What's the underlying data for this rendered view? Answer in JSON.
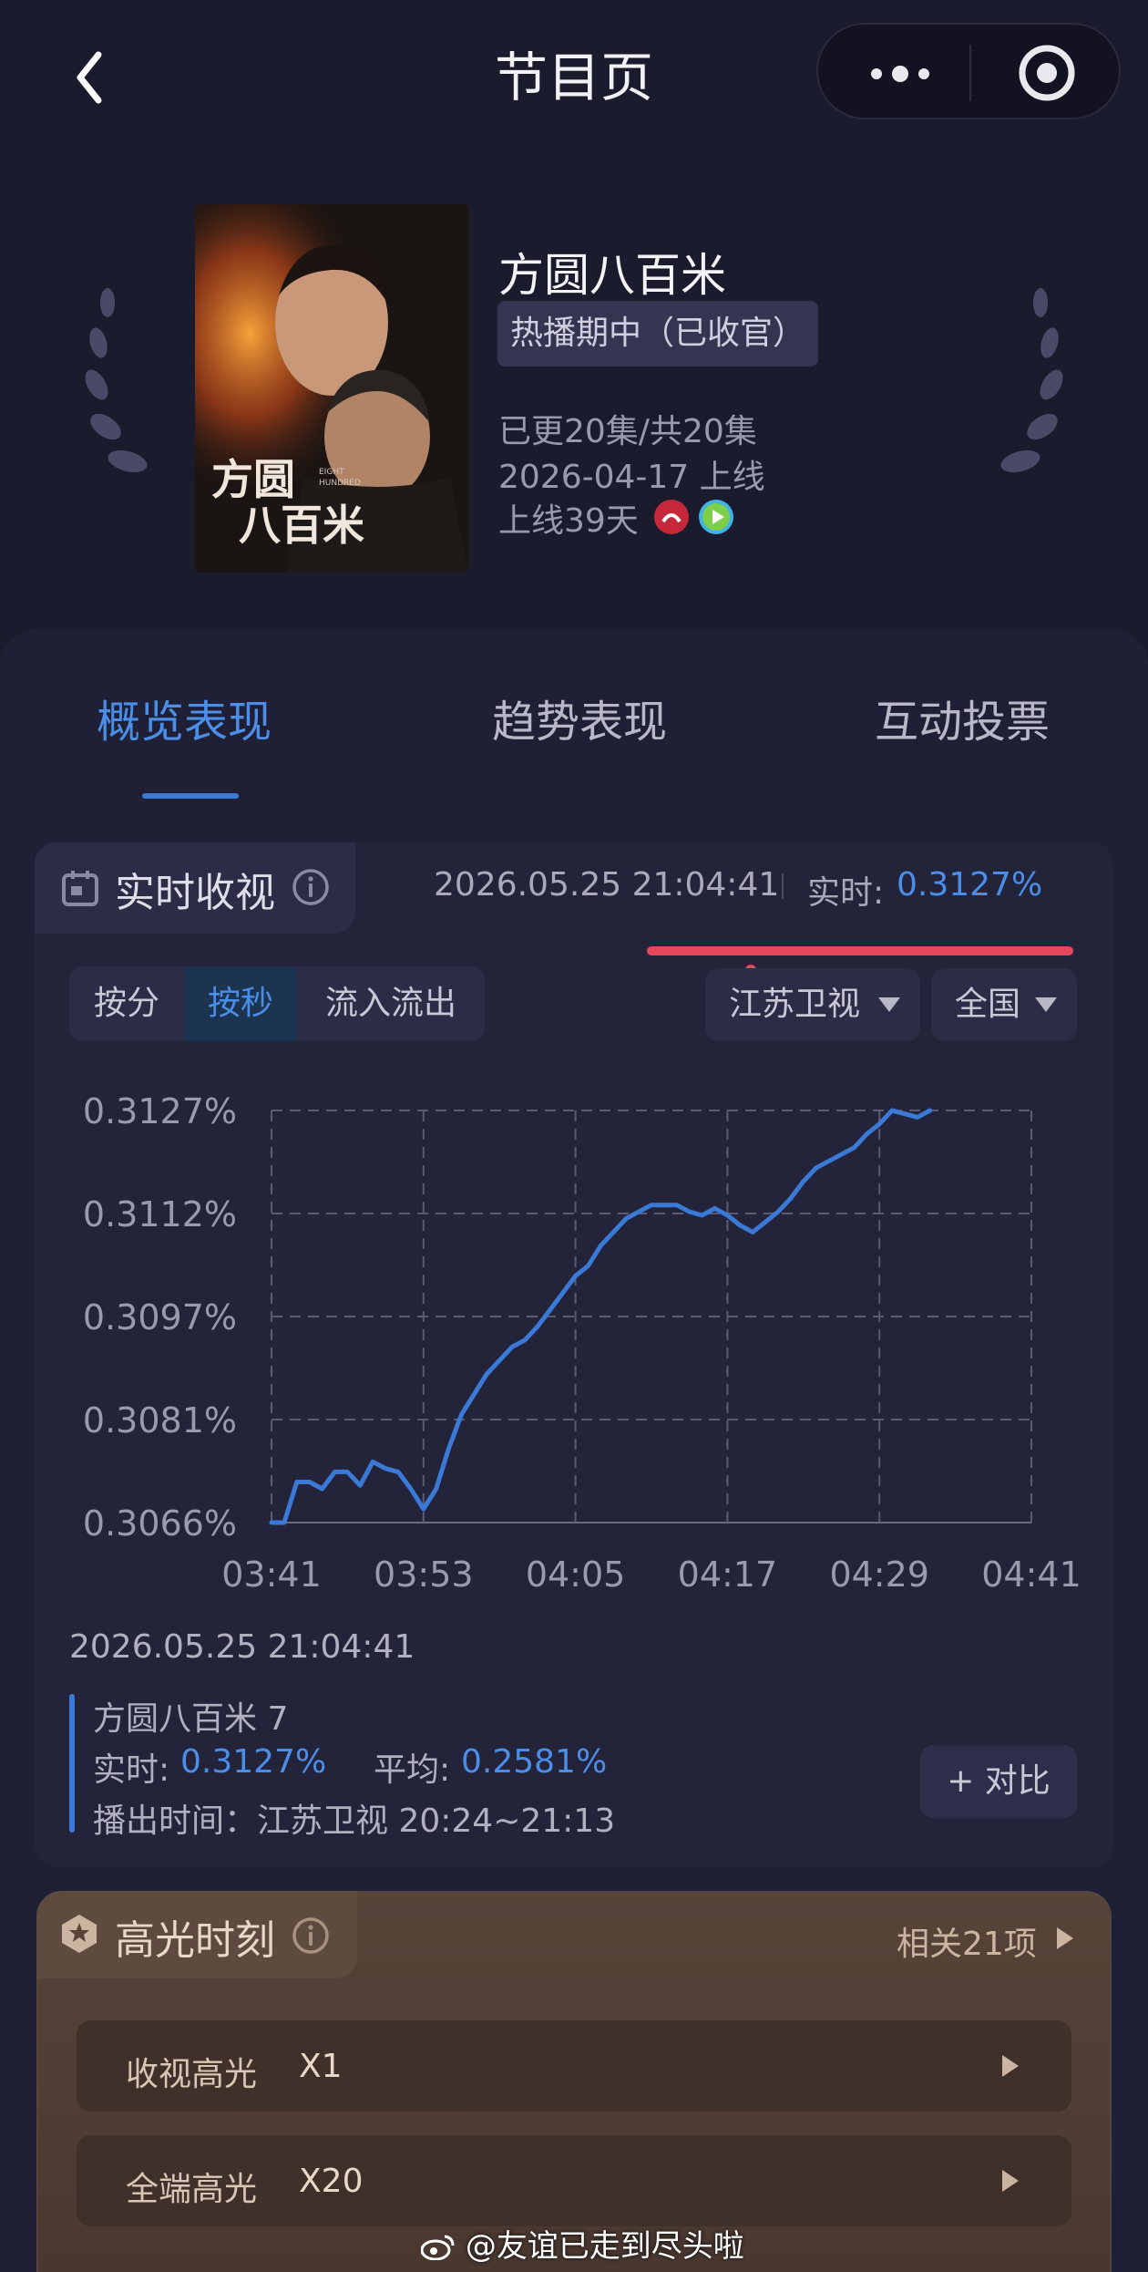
{
  "header": {
    "title": "节目页",
    "back_icon": "chevron-left-icon",
    "more_icon": "more-dots-icon",
    "capsule_close_icon": "target-circle-icon"
  },
  "show": {
    "name": "方圆八百米",
    "status": "热播期中（已收官）",
    "episodes": "已更20集/共20集",
    "release_date": "2026-04-17 上线",
    "days_online": "上线39天",
    "poster_title": "方圆八百米",
    "poster_subtitle": "EIGHT HUNDRED"
  },
  "tabs": [
    {
      "label": "概览表现",
      "active": true
    },
    {
      "label": "趋势表现"
    },
    {
      "label": "互动投票"
    }
  ],
  "realtime": {
    "title": "实时收视",
    "timestamp": "2026.05.25 21:04:41",
    "realtime_label": "实时:",
    "realtime_value": "0.3127%",
    "segments": [
      "按分",
      "按秒",
      "流入流出"
    ],
    "active_segment": "按秒",
    "channel": "江苏卫视",
    "region": "全国"
  },
  "chart_data": {
    "type": "line",
    "y_ticks": [
      "0.3127%",
      "0.3112%",
      "0.3097%",
      "0.3081%",
      "0.3066%"
    ],
    "x_ticks": [
      "03:41",
      "03:53",
      "04:05",
      "04:17",
      "04:29",
      "04:41"
    ],
    "ylim": [
      0.3066,
      0.3127
    ],
    "grid": true,
    "series": [
      {
        "color": "#3a7ad6",
        "x_minutes": [
          0,
          1,
          2,
          3,
          4,
          5,
          6,
          7,
          8,
          9,
          10,
          11,
          12,
          13,
          14,
          15,
          16,
          17,
          18,
          19,
          20,
          21,
          22,
          23,
          24,
          25,
          26,
          27,
          28,
          29,
          30,
          31,
          32,
          33,
          34,
          35,
          36,
          37,
          38,
          39,
          40,
          41,
          42,
          43,
          44,
          45,
          46,
          47,
          48,
          49,
          50,
          51,
          52,
          53,
          54,
          55,
          56,
          57,
          58,
          59,
          60
        ],
        "values": [
          0.3066,
          0.3066,
          0.3072,
          0.3072,
          0.3071,
          0.30735,
          0.30735,
          0.30715,
          0.3075,
          0.3074,
          0.30735,
          0.3071,
          0.3068,
          0.3071,
          0.3077,
          0.3082,
          0.3085,
          0.3088,
          0.309,
          0.3092,
          0.3093,
          0.3095,
          0.30975,
          0.31,
          0.31025,
          0.3104,
          0.3107,
          0.3109,
          0.3111,
          0.3112,
          0.3113,
          0.3113,
          0.3113,
          0.3112,
          0.31115,
          0.31125,
          0.31115,
          0.311,
          0.3109,
          0.31105,
          0.3112,
          0.3114,
          0.31165,
          0.31185,
          0.31195,
          0.31205,
          0.31215,
          0.31235,
          0.3125,
          0.3127,
          0.31265,
          0.3126,
          0.3127
        ]
      }
    ]
  },
  "legend": {
    "timestamp": "2026.05.25 21:04:41",
    "episode": "方圆八百米 7",
    "realtime_label": "实时:",
    "realtime_value": "0.3127%",
    "average_label": "平均:",
    "average_value": "0.2581%",
    "airtime": "播出时间：江苏卫视 20:24~21:13",
    "compare_button": "+ 对比"
  },
  "highlights": {
    "title": "高光时刻",
    "related": "相关21项",
    "items": [
      {
        "label": "收视高光",
        "value": "X1"
      },
      {
        "label": "全端高光",
        "value": "X20"
      }
    ]
  },
  "watermark": "@友谊已走到尽头啦"
}
